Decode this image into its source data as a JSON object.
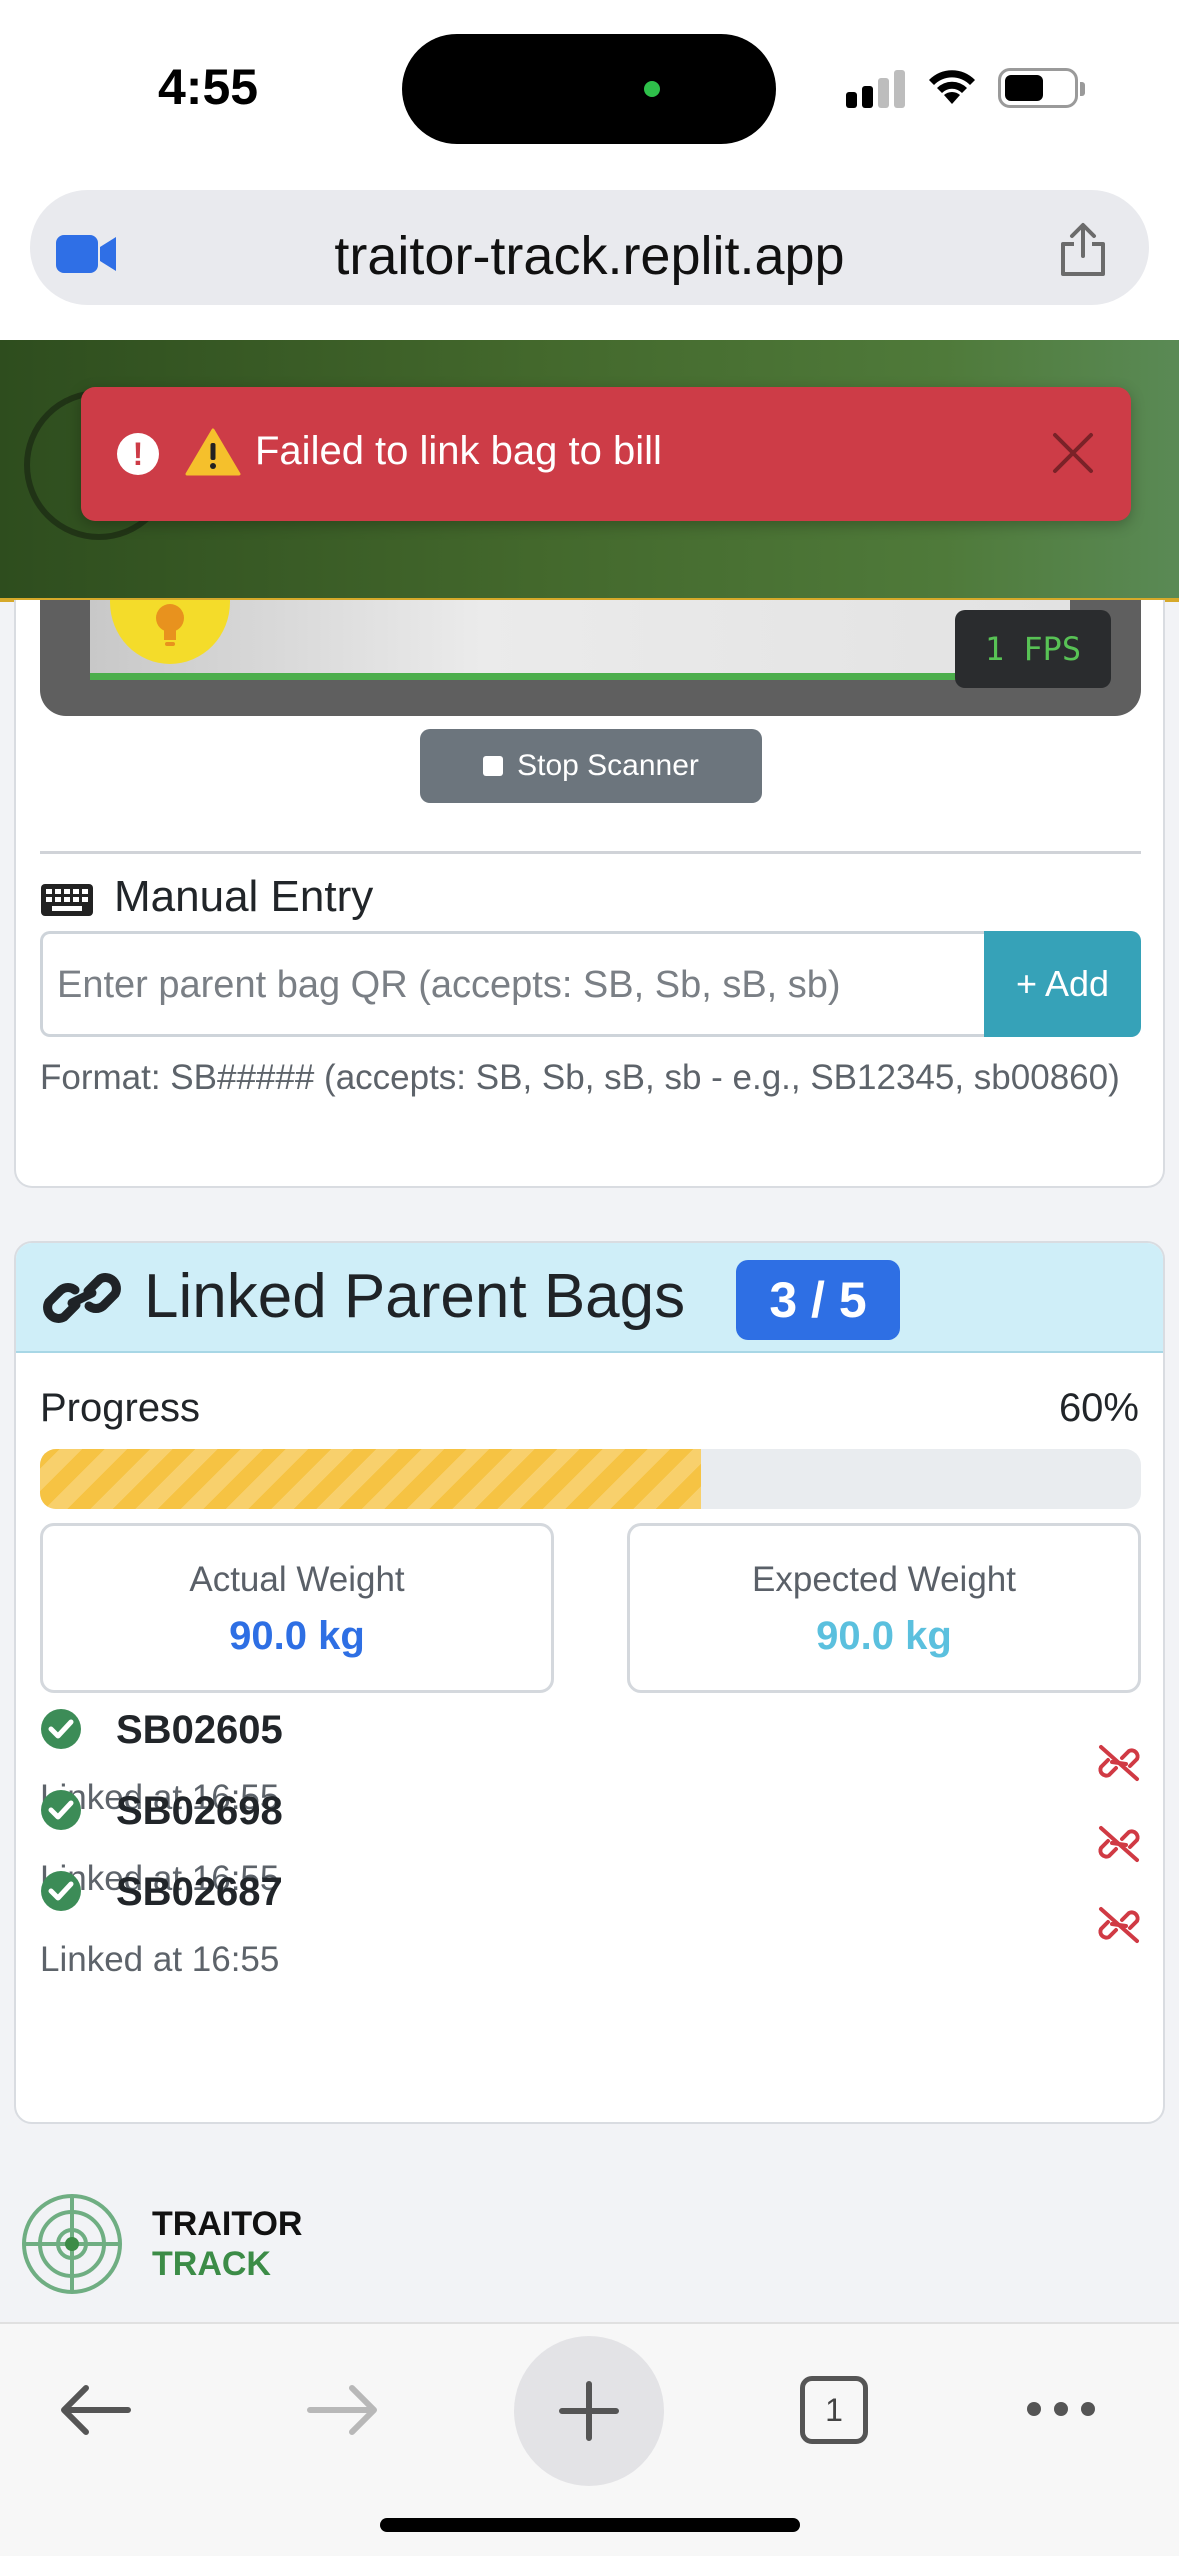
{
  "status_bar": {
    "time": "4:55"
  },
  "browser": {
    "url": "traitor-track.replit.app"
  },
  "toast": {
    "icon_warning": "⚠️",
    "message": "Failed to link bag to bill"
  },
  "scanner": {
    "fps_text": "1 FPS",
    "stop_label": "Stop Scanner"
  },
  "manual_entry": {
    "title": "Manual Entry",
    "placeholder": "Enter parent bag QR (accepts: SB, Sb, sB, sb)",
    "add_label": "+ Add",
    "format_help": "Format: SB##### (accepts: SB, Sb, sB, sb - e.g., SB12345, sb00860)"
  },
  "linked": {
    "title": "Linked Parent Bags",
    "badge": "3 / 5",
    "progress_label": "Progress",
    "progress_pct": "60%",
    "progress_value": 0.6,
    "actual_weight_label": "Actual Weight",
    "actual_weight_value": "90.0 kg",
    "expected_weight_label": "Expected Weight",
    "expected_weight_value": "90.0 kg",
    "bags": [
      {
        "id": "SB02605",
        "time": "Linked at 16:55"
      },
      {
        "id": "SB02698",
        "time": "Linked at 16:55"
      },
      {
        "id": "SB02687",
        "time": "Linked at 16:55"
      }
    ]
  },
  "footer": {
    "brand_line1": "TRAITOR",
    "brand_line2": "TRACK"
  },
  "toolbar": {
    "tab_count": "1"
  },
  "colors": {
    "header_green": "#43682c",
    "toast_red": "#cd3c47",
    "badge_blue": "#2e6fe4",
    "add_teal": "#36a2b8",
    "progress_yellow": "#f6c343",
    "actual_weight": "#2e6fe4",
    "expected_weight": "#5bc0de",
    "check_green": "#3c8c57",
    "unlink_red": "#d03a44"
  }
}
